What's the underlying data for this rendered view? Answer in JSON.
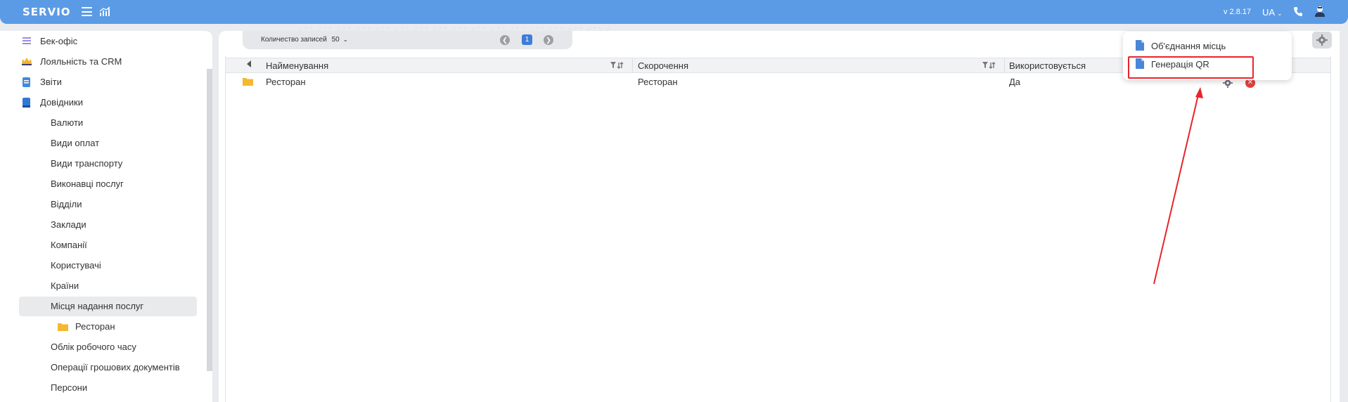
{
  "app": {
    "logo": "SERVIO",
    "version": "v 2.8.17",
    "language": "UA"
  },
  "colors": {
    "topbar": "#5b9be6",
    "accent": "#3d7dd8",
    "folder": "#f5b82e",
    "doc": "#4a86d8",
    "delete": "#e2403a",
    "annotation": "#e8242a"
  },
  "sidebar": {
    "items": [
      {
        "label": "Бек-офіс",
        "icon": "list-icon"
      },
      {
        "label": "Лояльність та CRM",
        "icon": "crown-icon"
      },
      {
        "label": "Звіти",
        "icon": "report-icon"
      },
      {
        "label": "Довідники",
        "icon": "book-icon"
      },
      {
        "label": "Валюти"
      },
      {
        "label": "Види оплат"
      },
      {
        "label": "Види транспорту"
      },
      {
        "label": "Виконавці послуг"
      },
      {
        "label": "Відділи"
      },
      {
        "label": "Заклади"
      },
      {
        "label": "Компанії"
      },
      {
        "label": "Користувачі"
      },
      {
        "label": "Країни"
      },
      {
        "label": "Місця надання послуг",
        "active": true
      },
      {
        "label": "Ресторан",
        "icon": "folder-icon"
      },
      {
        "label": "Облік робочого часу"
      },
      {
        "label": "Операції грошових документів"
      },
      {
        "label": "Персони"
      }
    ]
  },
  "pager": {
    "count_label": "Количество записей",
    "count_value": "50",
    "page": "1"
  },
  "table": {
    "columns": [
      "Найменування",
      "Скорочення",
      "Використовується"
    ],
    "rows": [
      {
        "name": "Ресторан",
        "short": "Ресторан",
        "used": "Да"
      }
    ]
  },
  "dropdown": {
    "items": [
      "Об'єднання місць",
      "Генерація QR"
    ]
  }
}
